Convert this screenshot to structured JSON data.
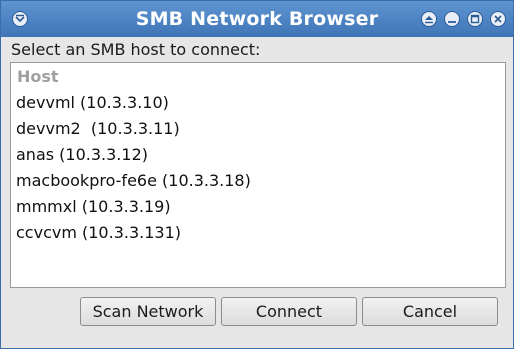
{
  "window": {
    "title": "SMB Network Browser"
  },
  "dialog": {
    "prompt": "Select an SMB host to connect:",
    "list_header": "Host",
    "hosts": [
      "devvml (10.3.3.10)",
      "devvm2  (10.3.3.11)",
      "anas (10.3.3.12)",
      "macbookpro-fe6e (10.3.3.18)",
      "mmmxl (10.3.3.19)",
      "ccvcvm (10.3.3.131)"
    ]
  },
  "buttons": {
    "scan": "Scan Network",
    "connect": "Connect",
    "cancel": "Cancel"
  },
  "colors": {
    "titlebar": "#4a82c4",
    "window_bg": "#e6e6e6",
    "header_text": "#a0a0a0"
  },
  "icons": {
    "window_menu": "chevron-down-icon",
    "shade": "shade-icon",
    "minimize": "minimize-icon",
    "maximize": "maximize-icon",
    "close": "close-icon"
  }
}
